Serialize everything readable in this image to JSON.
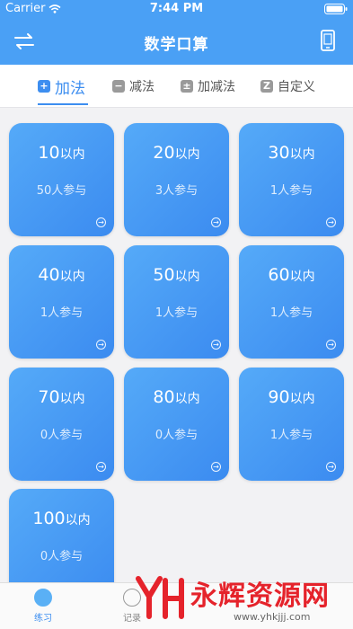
{
  "status": {
    "carrier": "Carrier",
    "time": "7:44 PM"
  },
  "nav": {
    "title": "数学口算"
  },
  "tabs": [
    {
      "label": "加法",
      "icon": "+",
      "active": true
    },
    {
      "label": "减法",
      "icon": "−",
      "active": false
    },
    {
      "label": "加减法",
      "icon": "±",
      "active": false
    },
    {
      "label": "自定义",
      "icon": "Z",
      "active": false
    }
  ],
  "cards": [
    {
      "num": "10",
      "suffix": "以内",
      "sub": "50人参与"
    },
    {
      "num": "20",
      "suffix": "以内",
      "sub": "3人参与"
    },
    {
      "num": "30",
      "suffix": "以内",
      "sub": "1人参与"
    },
    {
      "num": "40",
      "suffix": "以内",
      "sub": "1人参与"
    },
    {
      "num": "50",
      "suffix": "以内",
      "sub": "1人参与"
    },
    {
      "num": "60",
      "suffix": "以内",
      "sub": "1人参与"
    },
    {
      "num": "70",
      "suffix": "以内",
      "sub": "0人参与"
    },
    {
      "num": "80",
      "suffix": "以内",
      "sub": "0人参与"
    },
    {
      "num": "90",
      "suffix": "以内",
      "sub": "1人参与"
    },
    {
      "num": "100",
      "suffix": "以内",
      "sub": "0人参与"
    }
  ],
  "bottom": [
    {
      "label": "练习",
      "active": true
    },
    {
      "label": "记录",
      "active": false
    }
  ],
  "watermark": {
    "text": "永辉资源网",
    "url": "www.yhkjjj.com"
  },
  "colors": {
    "primary": "#4aa0f5",
    "accent": "#3d8ef0",
    "watermark": "#e5232b"
  }
}
